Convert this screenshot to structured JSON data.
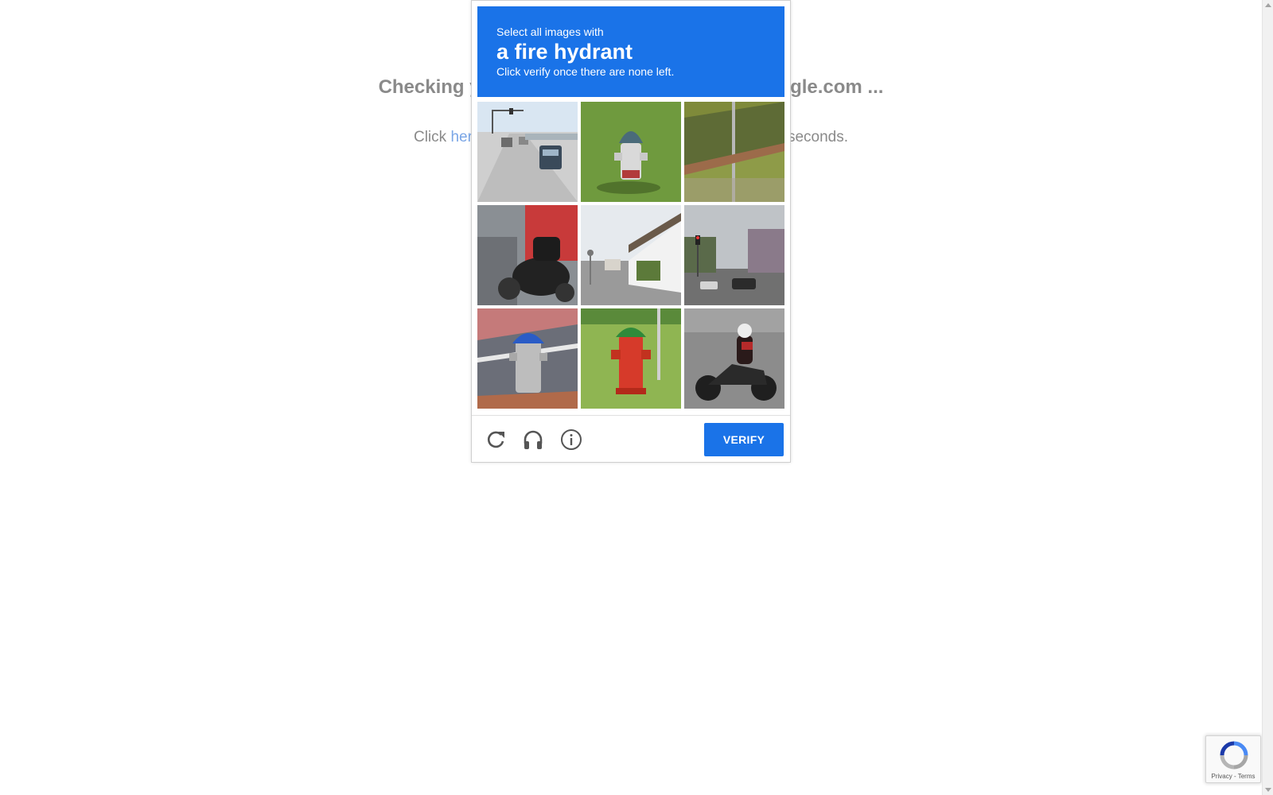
{
  "background": {
    "heading": "Checking your browser before accessing kaggle.com ...",
    "sub_prefix": "Click ",
    "sub_link": "here",
    "sub_suffix": " if you are not automatically redirected after 5 seconds."
  },
  "captcha": {
    "instruction_prefix": "Select all images with",
    "keyword": "a fire hydrant",
    "instruction_suffix": "Click verify once there are none left.",
    "header_color": "#1a73e8",
    "tiles": [
      {
        "subject": "highway-traffic"
      },
      {
        "subject": "fire-hydrant-on-grass"
      },
      {
        "subject": "fence-on-hillside"
      },
      {
        "subject": "scooter-parked"
      },
      {
        "subject": "street-houses"
      },
      {
        "subject": "street-traffic-light"
      },
      {
        "subject": "fire-hydrant-blue-cap"
      },
      {
        "subject": "fire-hydrant-red-green"
      },
      {
        "subject": "motorcycle-rider"
      }
    ],
    "icons": [
      "reload-icon",
      "audio-headphones-icon",
      "info-icon"
    ],
    "verify_label": "VERIFY"
  },
  "badge": {
    "privacy": "Privacy",
    "separator": " - ",
    "terms": "Terms"
  }
}
